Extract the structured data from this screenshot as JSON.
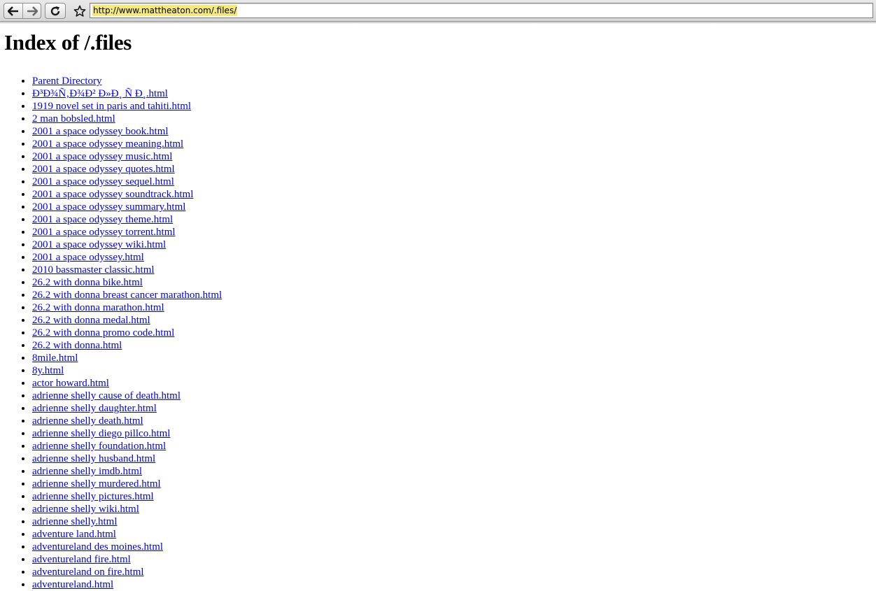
{
  "browser": {
    "url": "http://www.mattheaton.com/.files/",
    "back_icon": "back-arrow-icon",
    "forward_icon": "forward-arrow-icon",
    "reload_icon": "reload-icon",
    "bookmark_icon": "star-icon",
    "url_highlight_color": "#f5e97e"
  },
  "page": {
    "title": "Index of /.files",
    "link_color": "#0000ee",
    "items": [
      "Parent Directory",
      "Ð³Ð¾Ñ‚Ð¾Ð² Ð»Ð¸ Ñ Ð¸.html",
      "1919 novel set in paris and tahiti.html",
      "2 man bobsled.html",
      "2001 a space odyssey book.html",
      "2001 a space odyssey meaning.html",
      "2001 a space odyssey music.html",
      "2001 a space odyssey quotes.html",
      "2001 a space odyssey sequel.html",
      "2001 a space odyssey soundtrack.html",
      "2001 a space odyssey summary.html",
      "2001 a space odyssey theme.html",
      "2001 a space odyssey torrent.html",
      "2001 a space odyssey wiki.html",
      "2001 a space odyssey.html",
      "2010 bassmaster classic.html",
      "26.2 with donna bike.html",
      "26.2 with donna breast cancer marathon.html",
      "26.2 with donna marathon.html",
      "26.2 with donna medal.html",
      "26.2 with donna promo code.html",
      "26.2 with donna.html",
      "8mile.html",
      "8y.html",
      "actor howard.html",
      "adrienne shelly cause of death.html",
      "adrienne shelly daughter.html",
      "adrienne shelly death.html",
      "adrienne shelly diego pillco.html",
      "adrienne shelly foundation.html",
      "adrienne shelly husband.html",
      "adrienne shelly imdb.html",
      "adrienne shelly murdered.html",
      "adrienne shelly pictures.html",
      "adrienne shelly wiki.html",
      "adrienne shelly.html",
      "adventure land.html",
      "adventureland des moines.html",
      "adventureland fire.html",
      "adventureland on fire.html",
      "adventureland.html"
    ]
  }
}
